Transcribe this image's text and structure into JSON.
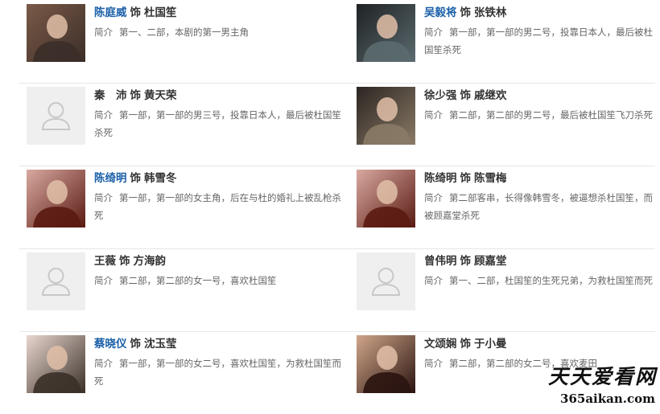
{
  "desc_label": "简介",
  "shi_label": "饰",
  "cast": [
    {
      "left": {
        "actor": "陈庭威",
        "role": "杜国笙",
        "desc": "第一、二部，本剧的第一男主角",
        "photo": "actor-photo",
        "link": true
      },
      "right": {
        "actor": "吴毅将",
        "role": "张铁林",
        "desc": "第一部，第一部的男二号，投靠日本人，最后被杜国笙杀死",
        "photo": "actor-photo",
        "link": true
      }
    },
    {
      "left": {
        "actor": "秦　沛",
        "role": "黄天荣",
        "desc": "第一部，第一部的男三号，投靠日本人，最后被杜国笙杀死",
        "photo": "placeholder",
        "link": false
      },
      "right": {
        "actor": "徐少强",
        "role": "戚继欢",
        "desc": "第二部，第二部的男二号，最后被杜国笙飞刀杀死",
        "photo": "actor-photo",
        "link": false
      }
    },
    {
      "left": {
        "actor": "陈绮明",
        "role": "韩雪冬",
        "desc": "第一部，第一部的女主角，后在与杜的婚礼上被乱枪杀死",
        "photo": "actor-photo",
        "link": true
      },
      "right": {
        "actor": "陈绮明",
        "role": "陈雪梅",
        "desc": "第二部客串，长得像韩雪冬，被逼想杀杜国笙，而被顾嘉堂杀死",
        "photo": "actor-photo",
        "link": false
      }
    },
    {
      "left": {
        "actor": "王薇",
        "role": "方海韵",
        "desc": "第二部，第二部的女一号，喜欢杜国笙",
        "photo": "placeholder",
        "link": false
      },
      "right": {
        "actor": "曾伟明",
        "role": "顾嘉堂",
        "desc": "第一、二部，杜国笙的生死兄弟，为救杜国笙而死",
        "photo": "placeholder",
        "link": false
      }
    },
    {
      "left": {
        "actor": "蔡晓仪",
        "role": "沈玉莹",
        "desc": "第一部，第一部的女二号，喜欢杜国笙，为救杜国笙而死",
        "photo": "actor-photo",
        "link": true
      },
      "right": {
        "actor": "文颂娴",
        "role": "于小曼",
        "desc": "第二部，第二部的女二号，喜欢麦田",
        "photo": "actor-photo",
        "link": false
      }
    }
  ],
  "watermark": {
    "cn": "天天爱看网",
    "url": "365aikan.com"
  }
}
